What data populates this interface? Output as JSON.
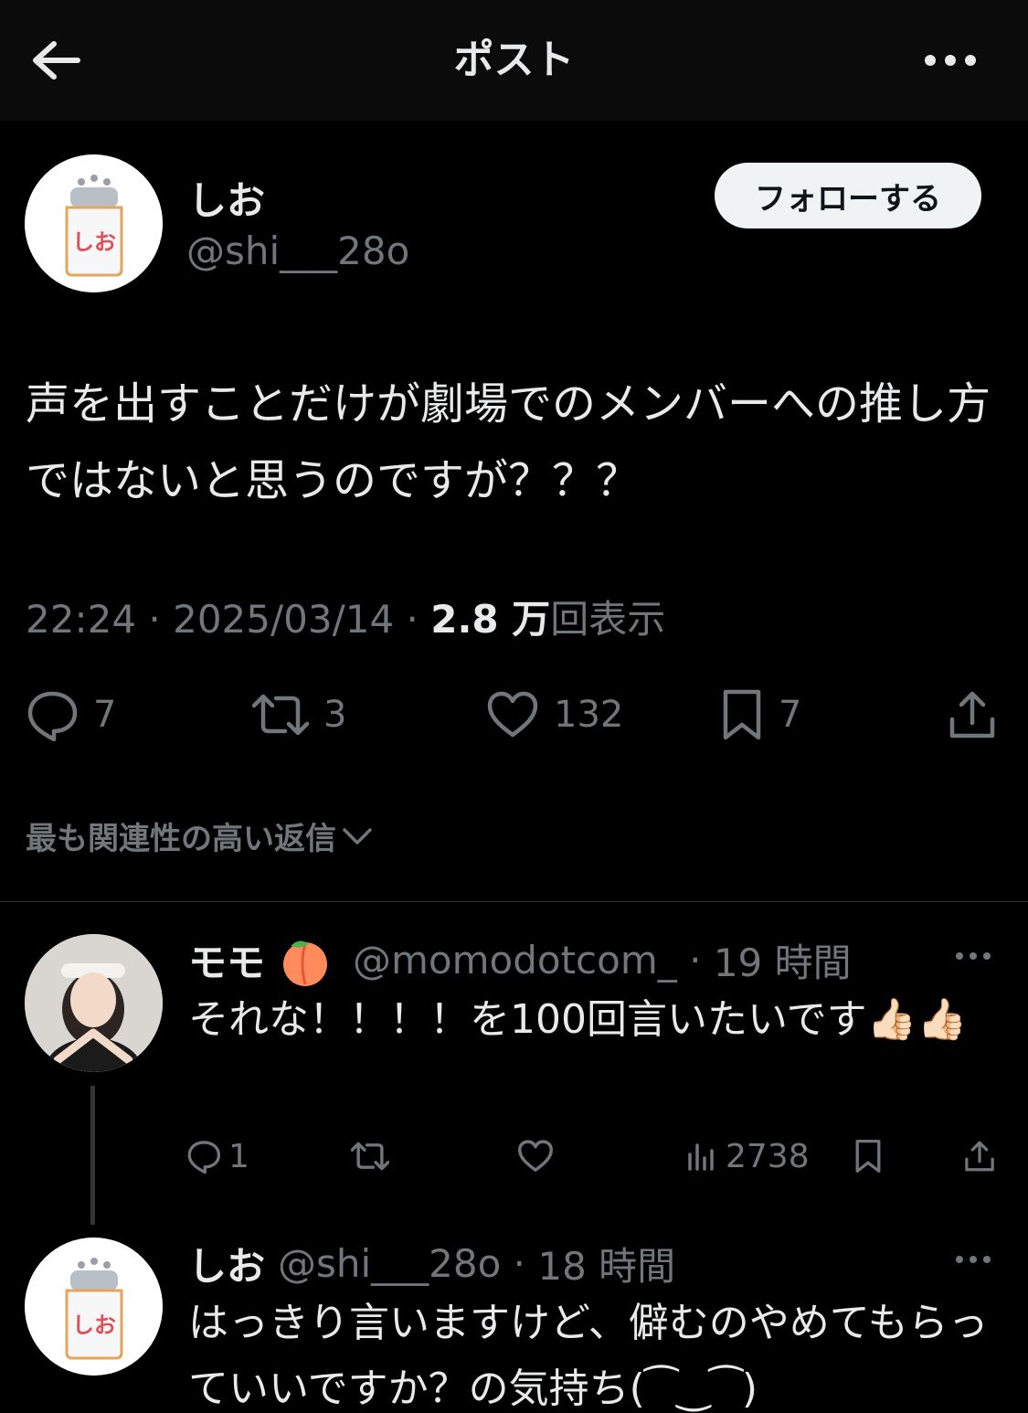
{
  "header": {
    "title": "ポスト",
    "back_icon": "arrow-left-icon",
    "more_icon": "more-horizontal-icon"
  },
  "post": {
    "author_name": "しお",
    "author_handle": "@shi___28o",
    "avatar_text": "しお",
    "follow_label": "フォローする",
    "text": "声を出すことだけが劇場でのメンバーへの推し方ではないと思うのですが？？？",
    "time": "22:24",
    "date": "2025/03/14",
    "views_value": "2.8 万",
    "views_suffix": "回表示",
    "replies": "7",
    "reposts": "3",
    "likes": "132",
    "bookmarks": "7"
  },
  "sort": {
    "label": "最も関連性の高い返信"
  },
  "replies": [
    {
      "name": "モモ",
      "handle": "@momodotcom_",
      "time": "19 時間",
      "text": "それな！！！！を100回言いたいです👍🏻👍🏻",
      "reply_count": "1",
      "views": "2738"
    },
    {
      "name": "しお",
      "handle": "@shi___28o",
      "time": "18 時間",
      "avatar_text": "しお",
      "text": "はっきり言いますけど、僻むのやめてもらっていいですか？の気持ち(⁀‿⁀)"
    }
  ],
  "colors": {
    "background": "#000000",
    "text": "#e7e9ea",
    "muted": "#71767b",
    "divider": "#2f3336",
    "follow_bg": "#eff3f4"
  }
}
